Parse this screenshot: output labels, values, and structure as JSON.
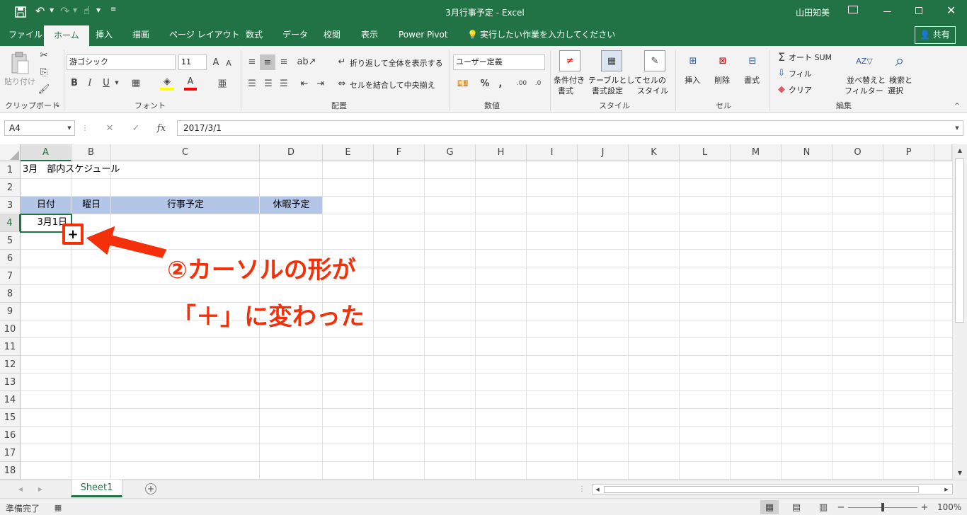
{
  "title": {
    "doc": "3月行事予定 - Excel",
    "user": "山田知美"
  },
  "tabs": [
    "ファイル",
    "ホーム",
    "挿入",
    "描画",
    "ページ レイアウト",
    "数式",
    "データ",
    "校閲",
    "表示",
    "Power Pivot"
  ],
  "tell_me": "実行したい作業を入力してください",
  "share": "共有",
  "ribbon": {
    "clipboard": {
      "paste": "貼り付け",
      "label": "クリップボード"
    },
    "font": {
      "name": "游ゴシック",
      "size": "11",
      "label": "フォント",
      "bold": "B",
      "italic": "I",
      "underline": "U"
    },
    "align": {
      "wrap": "折り返して全体を表示する",
      "merge": "セルを結合して中央揃え",
      "label": "配置"
    },
    "number": {
      "format": "ユーザー定義",
      "label": "数値"
    },
    "styles": {
      "cond1": "条件付き",
      "cond2": "書式",
      "table1": "テーブルとして",
      "table2": "書式設定",
      "cell1": "セルの",
      "cell2": "スタイル",
      "label": "スタイル"
    },
    "cells": {
      "insert": "挿入",
      "delete": "削除",
      "format": "書式",
      "label": "セル"
    },
    "editing": {
      "autosum": "オート SUM",
      "fill": "フィル",
      "clear": "クリア",
      "sort1": "並べ替えと",
      "sort2": "フィルター",
      "find1": "検索と",
      "find2": "選択",
      "label": "編集"
    }
  },
  "formula_bar": {
    "name_box": "A4",
    "formula": "2017/3/1"
  },
  "columns": [
    "A",
    "B",
    "C",
    "D",
    "E",
    "F",
    "G",
    "H",
    "I",
    "J",
    "K",
    "L",
    "M",
    "N",
    "O",
    "P"
  ],
  "rows": [
    "1",
    "2",
    "3",
    "4",
    "5",
    "6",
    "7",
    "8",
    "9",
    "10",
    "11",
    "12",
    "13",
    "14",
    "15",
    "16",
    "17",
    "18"
  ],
  "cells": {
    "A1": "3月　部内スケジュール",
    "A3": "日付",
    "B3": "曜日",
    "C3": "行事予定",
    "D3": "休暇予定",
    "A4": "3月1日"
  },
  "sheet_tabs": [
    "Sheet1"
  ],
  "status": {
    "ready": "準備完了",
    "zoom": "100%"
  },
  "callout": {
    "line1": "②カーソルの形が",
    "line2": "「＋」に変わった"
  },
  "colors": {
    "excel_green": "#217346",
    "header_fill": "#b4c6e7",
    "callout_red": "#f4300a"
  }
}
